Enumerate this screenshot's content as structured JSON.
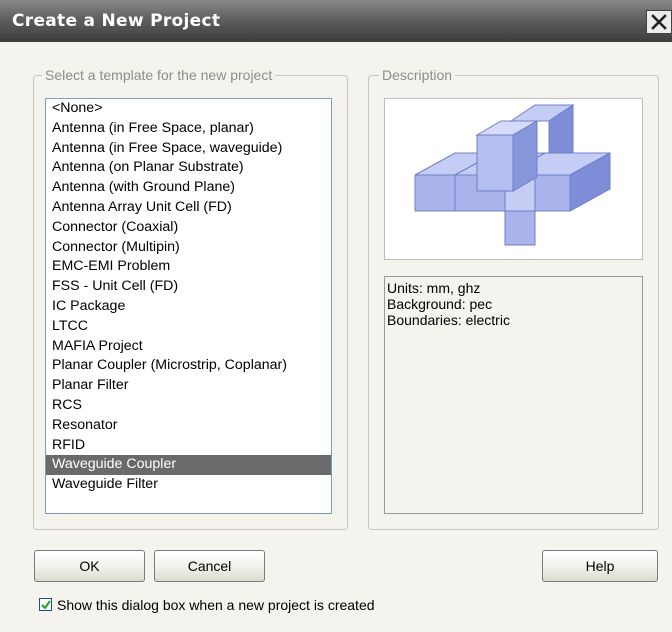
{
  "window": {
    "title": "Create a New Project",
    "close_icon": "close-icon"
  },
  "template_group": {
    "legend": "Select a template for the new project",
    "items": [
      "<None>",
      "Antenna (in Free Space, planar)",
      "Antenna (in Free Space, waveguide)",
      "Antenna (on Planar Substrate)",
      "Antenna (with Ground Plane)",
      "Antenna Array Unit Cell (FD)",
      "Connector (Coaxial)",
      "Connector (Multipin)",
      "EMC-EMI Problem",
      "FSS - Unit Cell (FD)",
      "IC Package",
      "LTCC",
      "MAFIA Project",
      "Planar Coupler (Microstrip, Coplanar)",
      "Planar Filter",
      "RCS",
      "Resonator",
      "RFID",
      "Waveguide Coupler",
      "Waveguide Filter"
    ],
    "selected": "Waveguide Coupler"
  },
  "description_group": {
    "legend": "Description",
    "preview_icon": "3d-waveguide-coupler-preview",
    "lines": [
      "Units: mm, ghz",
      "Background: pec",
      "Boundaries: electric"
    ]
  },
  "buttons": {
    "ok": "OK",
    "cancel": "Cancel",
    "help": "Help"
  },
  "checkbox": {
    "label": "Show this dialog box when a new project is created",
    "checked": true
  },
  "colors": {
    "selection": "#6a6a6a",
    "shape_top": "#c5cdf5",
    "shape_side": "#8c9ae0"
  }
}
